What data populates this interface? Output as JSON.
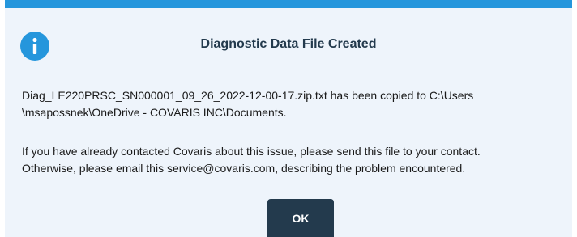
{
  "dialog": {
    "icon": "info-icon",
    "title": "Diagnostic Data File Created",
    "message_line1": "Diag_LE220PRSC_SN000001_09_26_2022-12-00-17.zip.txt has been copied to C:\\Users",
    "message_line2": "\\msapossnek\\OneDrive - COVARIS INC\\Documents.",
    "message_line3": "If you have already contacted Covaris about this issue, please send this file to your contact.",
    "message_line4": "Otherwise, please email this service@covaris.com, describing the problem encountered.",
    "ok_label": "OK"
  },
  "colors": {
    "accent": "#2596dc",
    "dialog_background": "#eef4fb",
    "button_background": "#233a4d",
    "title_text": "#233a4d"
  }
}
